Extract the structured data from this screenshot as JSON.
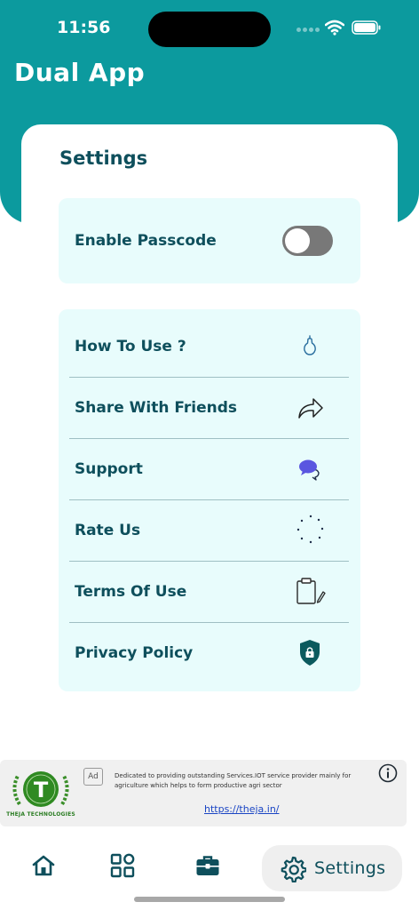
{
  "status_bar": {
    "time": "11:56"
  },
  "header": {
    "title": "Dual App"
  },
  "settings": {
    "title": "Settings",
    "passcode": {
      "label": "Enable Passcode",
      "enabled": false
    }
  },
  "menu": {
    "items": [
      {
        "label": "How To Use ?",
        "icon": "pear-icon"
      },
      {
        "label": "Share With Friends",
        "icon": "share-arrow-icon"
      },
      {
        "label": "Support",
        "icon": "chat-bubble-icon"
      },
      {
        "label": "Rate Us",
        "icon": "loading-spinner-icon"
      },
      {
        "label": "Terms Of Use",
        "icon": "clipboard-pen-icon"
      },
      {
        "label": "Privacy Policy",
        "icon": "shield-lock-icon"
      }
    ]
  },
  "ad": {
    "badge": "Ad",
    "brand": "THEJA TECHNOLOGIES",
    "logo_letter": "T",
    "text": "Dedicated to providing outstanding Services.IOT service provider mainly for agriculture which helps to form productive agri sector",
    "link": "https://theja.in/"
  },
  "bottom_nav": {
    "items": [
      {
        "icon": "home-icon"
      },
      {
        "icon": "grid-icon"
      },
      {
        "icon": "briefcase-icon"
      },
      {
        "icon": "gear-icon",
        "label": "Settings",
        "active": true
      }
    ]
  },
  "colors": {
    "primary": "#0c9a9e",
    "text_dark": "#0e4f5c",
    "panel_bg": "#e8fcfc",
    "toggle_off": "#787878",
    "link": "#1a45c4",
    "chat_accent": "#5a56e0"
  }
}
